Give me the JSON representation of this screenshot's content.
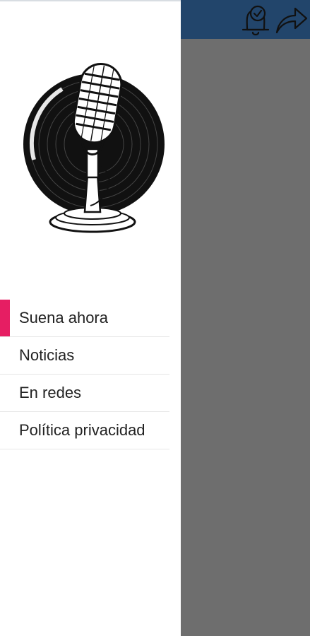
{
  "app": {
    "accent_color": "#e61e63",
    "header_color": "#22456b",
    "scrim_color": "#6e6e6e"
  },
  "header": {
    "icons": [
      "bell-check-icon",
      "share-arrow-icon"
    ]
  },
  "drawer": {
    "logo_icon": "microphone-vinyl-logo",
    "selected_index": 0,
    "items": [
      {
        "label": "Suena ahora"
      },
      {
        "label": "Noticias"
      },
      {
        "label": "En redes"
      },
      {
        "label": "Política privacidad"
      }
    ]
  }
}
